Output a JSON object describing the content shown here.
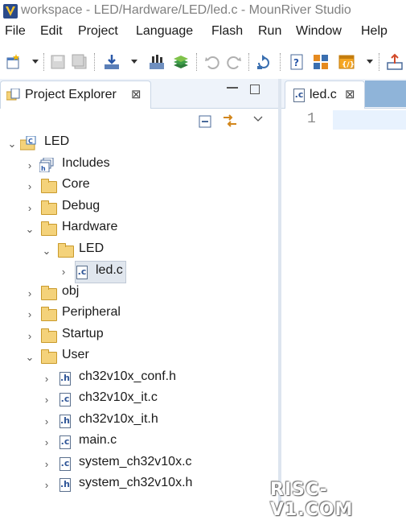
{
  "window": {
    "title": "workspace - LED/Hardware/LED/led.c - MounRiver Studio"
  },
  "menu": [
    "File",
    "Edit",
    "Project",
    "Language",
    "Flash",
    "Run",
    "Window",
    "Help"
  ],
  "toolbar": {
    "icons": [
      "new-icon",
      "save-icon",
      "save-all-icon",
      "download-icon",
      "build-icon",
      "build-all-icon",
      "undo-icon",
      "redo-icon",
      "refresh-icon",
      "help-doc-icon",
      "puzzle-icon",
      "run-config-icon",
      "export-icon"
    ]
  },
  "project_explorer": {
    "tab_label": "Project Explorer",
    "close_glyph": "⊠",
    "tree": [
      {
        "label": "LED",
        "type": "project",
        "expanded": true
      },
      {
        "label": "Includes",
        "type": "includes",
        "expanded": false
      },
      {
        "label": "Core",
        "type": "folder",
        "expanded": false
      },
      {
        "label": "Debug",
        "type": "folder",
        "expanded": false
      },
      {
        "label": "Hardware",
        "type": "folder",
        "expanded": true
      },
      {
        "label": "LED",
        "type": "folder",
        "expanded": true
      },
      {
        "label": "led.c",
        "type": "c-file",
        "expanded": false,
        "selected": true
      },
      {
        "label": "obj",
        "type": "folder",
        "expanded": false
      },
      {
        "label": "Peripheral",
        "type": "folder",
        "expanded": false
      },
      {
        "label": "Startup",
        "type": "folder",
        "expanded": false
      },
      {
        "label": "User",
        "type": "folder",
        "expanded": true
      },
      {
        "label": "ch32v10x_conf.h",
        "type": "h-file",
        "expanded": false
      },
      {
        "label": "ch32v10x_it.c",
        "type": "c-file",
        "expanded": false
      },
      {
        "label": "ch32v10x_it.h",
        "type": "h-file",
        "expanded": false
      },
      {
        "label": "main.c",
        "type": "c-file",
        "expanded": false
      },
      {
        "label": "system_ch32v10x.c",
        "type": "c-file",
        "expanded": false
      },
      {
        "label": "system_ch32v10x.h",
        "type": "h-file",
        "expanded": false
      }
    ]
  },
  "editor": {
    "tab_label": "led.c",
    "close_glyph": "⊠",
    "line_number": "1"
  },
  "watermark": "RISC-V1.COM"
}
